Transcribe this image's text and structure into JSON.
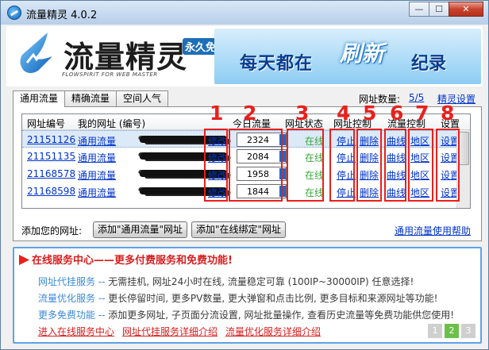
{
  "window": {
    "title": "流量精灵 4.0.2",
    "controls": {
      "minimize": "—",
      "maximize": "☐",
      "close": "✕"
    }
  },
  "banner": {
    "app_name": "流量精灵",
    "tagline_small": "FLOWSPIRIT FOR WEB MASTER",
    "badge": "永久免费",
    "slogan_part1": "每天都在",
    "slogan_part2": "刷新",
    "slogan_part3": "纪录"
  },
  "tabs": [
    {
      "label": "通用流量",
      "active": true
    },
    {
      "label": "精确流量",
      "active": false
    },
    {
      "label": "空间人气",
      "active": false
    }
  ],
  "site_count": {
    "label": "网址数量:",
    "value": "5/5"
  },
  "settings_link": "精灵设置",
  "table": {
    "columns": [
      "网址编号",
      "我的网址 (编号)",
      "今日流量",
      "网址状态",
      "网址控制",
      "流量控制",
      "设置"
    ],
    "rows": [
      {
        "id": "21151126",
        "site": "通用流量",
        "edit": "修改",
        "traffic": "2324",
        "status": "在线",
        "stop": "停止",
        "delete": "删除",
        "curve": "曲线",
        "region": "地区",
        "setting": "设置",
        "selected": true
      },
      {
        "id": "21151135",
        "site": "通用流量",
        "edit": "修改",
        "traffic": "2084",
        "status": "在线",
        "stop": "停止",
        "delete": "删除",
        "curve": "曲线",
        "region": "地区",
        "setting": "设置",
        "selected": false
      },
      {
        "id": "21168578",
        "site": "通用流量",
        "edit": "修改",
        "traffic": "1958",
        "status": "在线",
        "stop": "停止",
        "delete": "删除",
        "curve": "曲线",
        "region": "地区",
        "setting": "设置",
        "selected": false
      },
      {
        "id": "21168598",
        "site": "通用流量",
        "edit": "修改",
        "traffic": "1844",
        "status": "在线",
        "stop": "停止",
        "delete": "删除",
        "curve": "曲线",
        "region": "地区",
        "setting": "设置",
        "selected": false
      }
    ]
  },
  "annotations": [
    "1",
    "2",
    "3",
    "4",
    "5",
    "6",
    "7",
    "8"
  ],
  "add_site": {
    "label": "添加您的网址:",
    "btn_general": "添加\"通用流量\"网址",
    "btn_online": "添加\"在线绑定\"网址"
  },
  "help_link": "通用流量使用帮助",
  "service": {
    "title": "在线服务中心——更多付费服务和免费功能!",
    "lines": [
      {
        "head": "网址代挂服务 --",
        "body": " 无需挂机, 网址24小时在线, 流量稳定可靠 (100IP~30000IP) 任意选择!"
      },
      {
        "head": "流量优化服务 --",
        "body": " 更长停留时间, 更多PV数量, 更大弹窗和点击比例, 更多目标和来源网址等功能!"
      },
      {
        "head": "更多免费功能 --",
        "body": " 添加更多网址, 子页面分流设置, 网址批量操作, 查看历史流量等免费功能供您使用!"
      }
    ],
    "links": [
      "进入在线服务中心",
      "网址代挂服务详细介绍",
      "流量优化服务详细介绍"
    ],
    "pages": [
      "1",
      "2",
      "3"
    ],
    "active_page": "2"
  }
}
